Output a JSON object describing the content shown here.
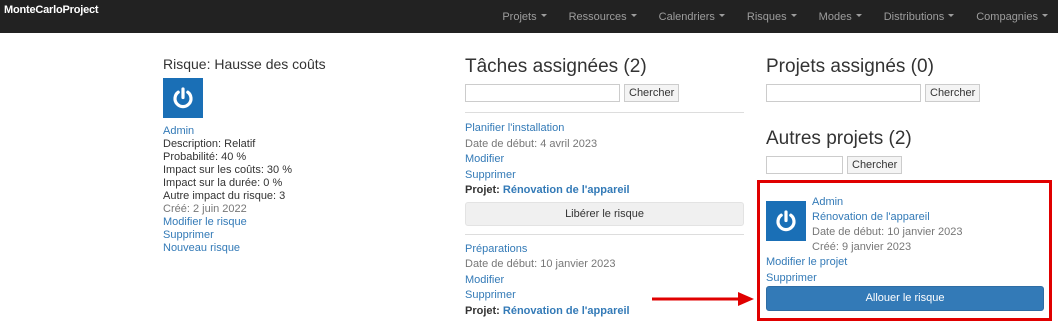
{
  "app": {
    "brand": "MonteCarloProject"
  },
  "nav": {
    "items": [
      {
        "label": "Projets"
      },
      {
        "label": "Ressources"
      },
      {
        "label": "Calendriers"
      },
      {
        "label": "Risques"
      },
      {
        "label": "Modes"
      },
      {
        "label": "Distributions"
      },
      {
        "label": "Compagnies"
      }
    ]
  },
  "risk": {
    "title": "Risque: Hausse des coûts",
    "avatar_icon": "power-icon",
    "owner": "Admin",
    "description": "Description: Relatif",
    "probability": "Probabilité: 40 %",
    "cost_impact": "Impact sur les coûts: 30 %",
    "duration_impact": "Impact sur la durée: 0 %",
    "other_impact": "Autre impact du risque: 3",
    "created": "Créé: 2 juin 2022",
    "edit_link": "Modifier le risque",
    "delete_link": "Supprimer",
    "new_link": "Nouveau risque"
  },
  "tasks": {
    "title": "Tâches assignées (2)",
    "search_button": "Chercher",
    "search_value": "",
    "items": [
      {
        "name": "Planifier l'installation",
        "start": "Date de début: 4 avril 2023",
        "edit": "Modifier",
        "delete": "Supprimer",
        "project_label": "Projet:",
        "project_name": "Rénovation de l'appareil",
        "release_button": "Libérer le risque"
      },
      {
        "name": "Préparations",
        "start": "Date de début: 10 janvier 2023",
        "edit": "Modifier",
        "delete": "Supprimer",
        "project_label": "Projet:",
        "project_name": "Rénovation de l'appareil"
      }
    ]
  },
  "assigned_projects": {
    "title": "Projets assignés (0)",
    "search_button": "Chercher",
    "search_value": ""
  },
  "other_projects": {
    "title": "Autres projets (2)",
    "search_button": "Chercher",
    "search_value": "",
    "items": [
      {
        "avatar_icon": "power-icon",
        "owner": "Admin",
        "name": "Rénovation de l'appareil",
        "start": "Date de début: 10 janvier 2023",
        "created": "Créé: 9 janvier 2023",
        "edit": "Modifier le projet",
        "delete": "Supprimer",
        "allocate_button": "Allouer le risque"
      }
    ]
  },
  "annotation": {
    "highlight_color": "#e00000",
    "arrow_color": "#e00000"
  }
}
